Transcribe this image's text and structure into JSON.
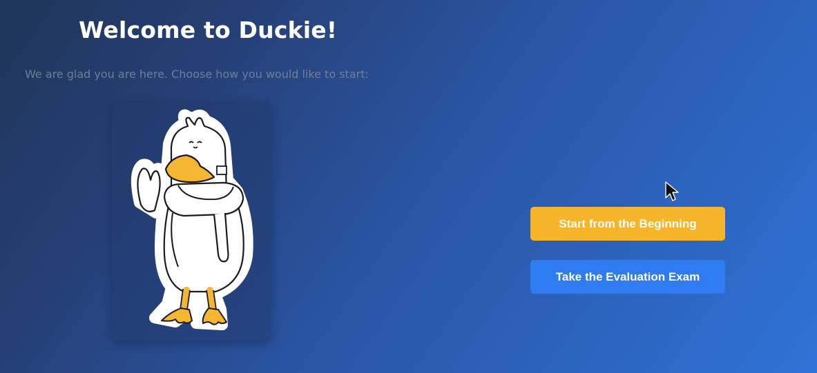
{
  "header": {
    "title": "Welcome to Duckie!",
    "subtitle": "We are glad you are here. Choose how you would like to start:"
  },
  "illustration": {
    "icon": "duck-mascot-waving"
  },
  "actions": {
    "start_label": "Start from the Beginning",
    "exam_label": "Take the Evaluation Exam"
  },
  "colors": {
    "start_button": "#f7b52c",
    "exam_button": "#2f7cf2",
    "beak_and_feet": "#f5b731"
  }
}
